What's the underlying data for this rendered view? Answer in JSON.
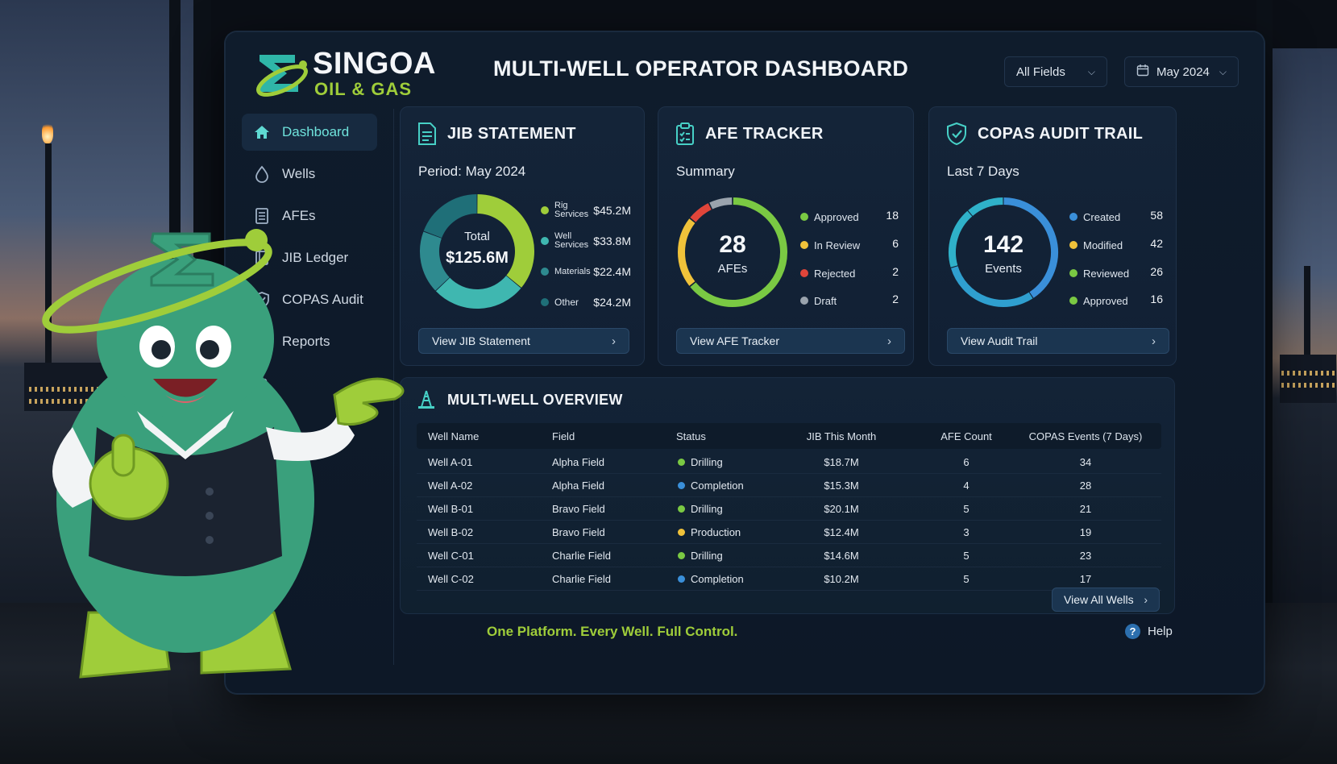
{
  "brand": {
    "name": "SINGOA",
    "tagline": "OIL & GAS",
    "primary": "#9fcd3a",
    "accent": "#3fd0c4"
  },
  "header": {
    "title": "MULTI-WELL OPERATOR DASHBOARD",
    "field_filter": "All Fields",
    "date_filter": "May 2024"
  },
  "sidebar": {
    "items": [
      {
        "label": "Dashboard",
        "icon": "home-icon",
        "active": true
      },
      {
        "label": "Wells",
        "icon": "drop-icon"
      },
      {
        "label": "AFEs",
        "icon": "document-icon"
      },
      {
        "label": "JIB Ledger",
        "icon": "ledger-icon"
      },
      {
        "label": "COPAS Audit",
        "icon": "shield-icon"
      },
      {
        "label": "Reports",
        "icon": "reports-icon"
      }
    ],
    "settings_icon": "gear-icon"
  },
  "jib": {
    "title": "JIB STATEMENT",
    "period": "Period: May 2024",
    "center_label": "Total",
    "center_value": "$125.6M",
    "legend": [
      {
        "label": "Rig Services",
        "value": "$45.2M",
        "color": "#9fcd3a",
        "amount": 45.2
      },
      {
        "label": "Well Services",
        "value": "$33.8M",
        "color": "#3fb7b0",
        "amount": 33.8
      },
      {
        "label": "Materials",
        "value": "$22.4M",
        "color": "#2e8a8f",
        "amount": 22.4
      },
      {
        "label": "Other",
        "value": "$24.2M",
        "color": "#1f6f78",
        "amount": 24.2
      }
    ],
    "button": "View JIB Statement"
  },
  "afe": {
    "title": "AFE TRACKER",
    "subtitle": "Summary",
    "center_value": "28",
    "center_label": "AFEs",
    "legend": [
      {
        "label": "Approved",
        "value": "18",
        "color": "#7ac943",
        "amount": 18
      },
      {
        "label": "In Review",
        "value": "6",
        "color": "#f0c23a",
        "amount": 6
      },
      {
        "label": "Rejected",
        "value": "2",
        "color": "#e0453a",
        "amount": 2
      },
      {
        "label": "Draft",
        "value": "2",
        "color": "#9aa3ad",
        "amount": 2
      }
    ],
    "button": "View AFE Tracker"
  },
  "copas": {
    "title": "COPAS AUDIT TRAIL",
    "subtitle": "Last 7 Days",
    "center_value": "142",
    "center_label": "Events",
    "legend": [
      {
        "label": "Created",
        "value": "58",
        "color": "#3a8fd9",
        "amount": 58
      },
      {
        "label": "Modified",
        "value": "42",
        "color": "#f0c23a",
        "amount": 42
      },
      {
        "label": "Reviewed",
        "value": "26",
        "color": "#7ac943",
        "amount": 26
      },
      {
        "label": "Approved",
        "value": "16",
        "color": "#7ac943",
        "amount": 16
      }
    ],
    "button": "View Audit Trail"
  },
  "overview": {
    "title": "MULTI-WELL OVERVIEW",
    "columns": [
      "Well Name",
      "Field",
      "Status",
      "JIB This Month",
      "AFE Count",
      "COPAS Events (7 Days)"
    ],
    "rows": [
      {
        "well": "Well A-01",
        "field": "Alpha Field",
        "status": "Drilling",
        "status_color": "#7ac943",
        "jib": "$18.7M",
        "afe": "6",
        "copas": "34"
      },
      {
        "well": "Well A-02",
        "field": "Alpha Field",
        "status": "Completion",
        "status_color": "#3a8fd9",
        "jib": "$15.3M",
        "afe": "4",
        "copas": "28"
      },
      {
        "well": "Well B-01",
        "field": "Bravo Field",
        "status": "Drilling",
        "status_color": "#7ac943",
        "jib": "$20.1M",
        "afe": "5",
        "copas": "21"
      },
      {
        "well": "Well B-02",
        "field": "Bravo Field",
        "status": "Production",
        "status_color": "#f0c23a",
        "jib": "$12.4M",
        "afe": "3",
        "copas": "19"
      },
      {
        "well": "Well C-01",
        "field": "Charlie Field",
        "status": "Drilling",
        "status_color": "#7ac943",
        "jib": "$14.6M",
        "afe": "5",
        "copas": "23"
      },
      {
        "well": "Well C-02",
        "field": "Charlie Field",
        "status": "Completion",
        "status_color": "#3a8fd9",
        "jib": "$10.2M",
        "afe": "5",
        "copas": "17"
      }
    ],
    "button": "View All Wells"
  },
  "footer": {
    "tagline": "One Platform. Every Well. Full Control.",
    "help": "Help"
  }
}
